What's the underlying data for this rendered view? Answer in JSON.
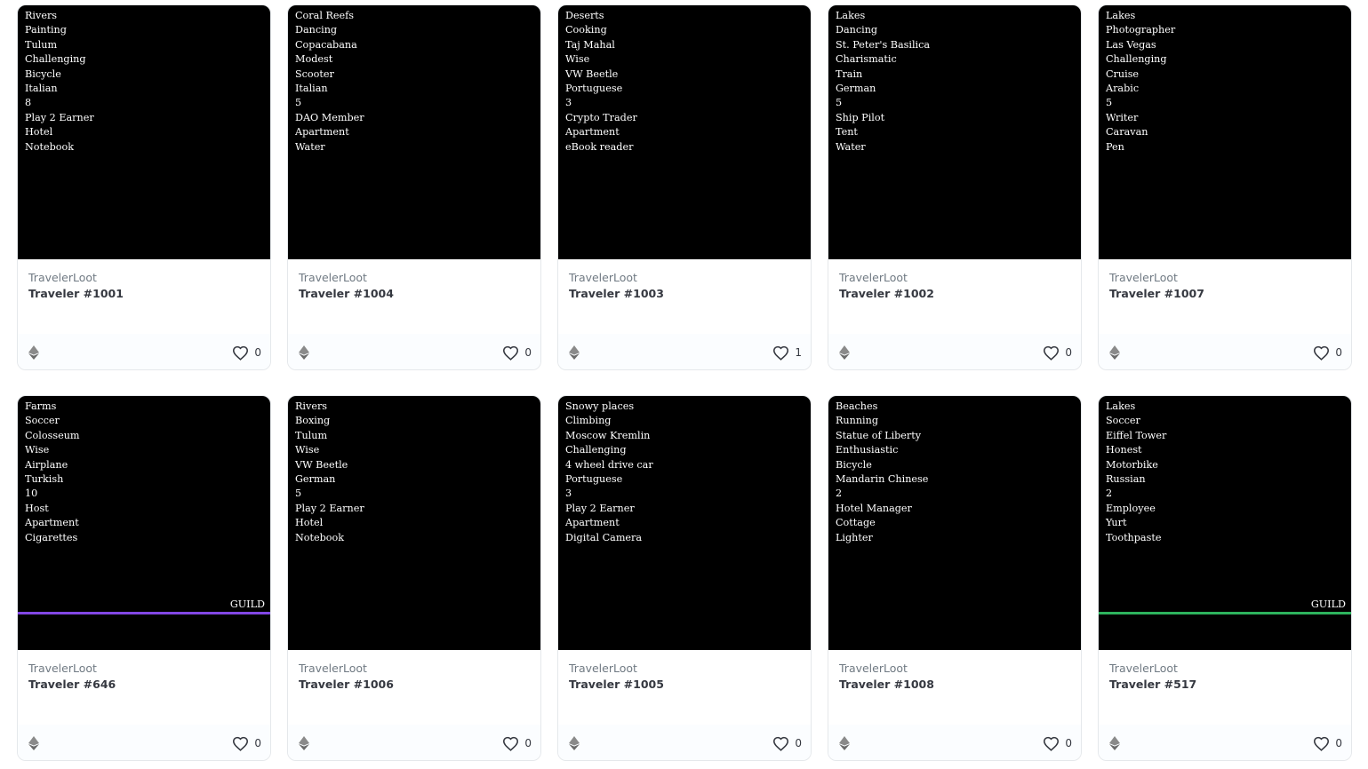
{
  "cards": [
    {
      "collection": "TravelerLoot",
      "name": "Traveler #1001",
      "likes": "0",
      "guild": null,
      "traits": [
        "Rivers",
        "Painting",
        "Tulum",
        "Challenging",
        "Bicycle",
        "Italian",
        "8",
        "Play 2 Earner",
        "Hotel",
        "Notebook"
      ]
    },
    {
      "collection": "TravelerLoot",
      "name": "Traveler #1004",
      "likes": "0",
      "guild": null,
      "traits": [
        "Coral Reefs",
        "Dancing",
        "Copacabana",
        "Modest",
        "Scooter",
        "Italian",
        "5",
        "DAO Member",
        "Apartment",
        "Water"
      ]
    },
    {
      "collection": "TravelerLoot",
      "name": "Traveler #1003",
      "likes": "1",
      "guild": null,
      "traits": [
        "Deserts",
        "Cooking",
        "Taj Mahal",
        "Wise",
        "VW Beetle",
        "Portuguese",
        "3",
        "Crypto Trader",
        "Apartment",
        "eBook reader"
      ]
    },
    {
      "collection": "TravelerLoot",
      "name": "Traveler #1002",
      "likes": "0",
      "guild": null,
      "traits": [
        "Lakes",
        "Dancing",
        "St. Peter's Basilica",
        "Charismatic",
        "Train",
        "German",
        "5",
        "Ship Pilot",
        "Tent",
        "Water"
      ]
    },
    {
      "collection": "TravelerLoot",
      "name": "Traveler #1007",
      "likes": "0",
      "guild": null,
      "traits": [
        "Lakes",
        "Photographer",
        "Las Vegas",
        "Challenging",
        "Cruise",
        "Arabic",
        "5",
        "Writer",
        "Caravan",
        "Pen"
      ]
    },
    {
      "collection": "TravelerLoot",
      "name": "Traveler #646",
      "likes": "0",
      "guild": {
        "label": "GUILD",
        "color": "#8247e5"
      },
      "traits": [
        "Farms",
        "Soccer",
        "Colosseum",
        "Wise",
        "Airplane",
        "Turkish",
        "10",
        "Host",
        "Apartment",
        "Cigarettes"
      ]
    },
    {
      "collection": "TravelerLoot",
      "name": "Traveler #1006",
      "likes": "0",
      "guild": null,
      "traits": [
        "Rivers",
        "Boxing",
        "Tulum",
        "Wise",
        "VW Beetle",
        "German",
        "5",
        "Play 2 Earner",
        "Hotel",
        "Notebook"
      ]
    },
    {
      "collection": "TravelerLoot",
      "name": "Traveler #1005",
      "likes": "0",
      "guild": null,
      "traits": [
        "Snowy places",
        "Climbing",
        "Moscow Kremlin",
        "Challenging",
        "4 wheel drive car",
        "Portuguese",
        "3",
        "Play 2 Earner",
        "Apartment",
        "Digital Camera"
      ]
    },
    {
      "collection": "TravelerLoot",
      "name": "Traveler #1008",
      "likes": "0",
      "guild": null,
      "traits": [
        "Beaches",
        "Running",
        "Statue of Liberty",
        "Enthusiastic",
        "Bicycle",
        "Mandarin Chinese",
        "2",
        "Hotel Manager",
        "Cottage",
        "Lighter"
      ]
    },
    {
      "collection": "TravelerLoot",
      "name": "Traveler #517",
      "likes": "0",
      "guild": {
        "label": "GUILD",
        "color": "#2db35d"
      },
      "traits": [
        "Lakes",
        "Soccer",
        "Eiffel Tower",
        "Honest",
        "Motorbike",
        "Russian",
        "2",
        "Employee",
        "Yurt",
        "Toothpaste"
      ]
    }
  ],
  "icons": {
    "currency": "ethereum-icon",
    "like": "heart-icon"
  },
  "colors": {
    "art_bg": "#000000",
    "collection_text": "#707a83",
    "name_text": "#353840"
  }
}
